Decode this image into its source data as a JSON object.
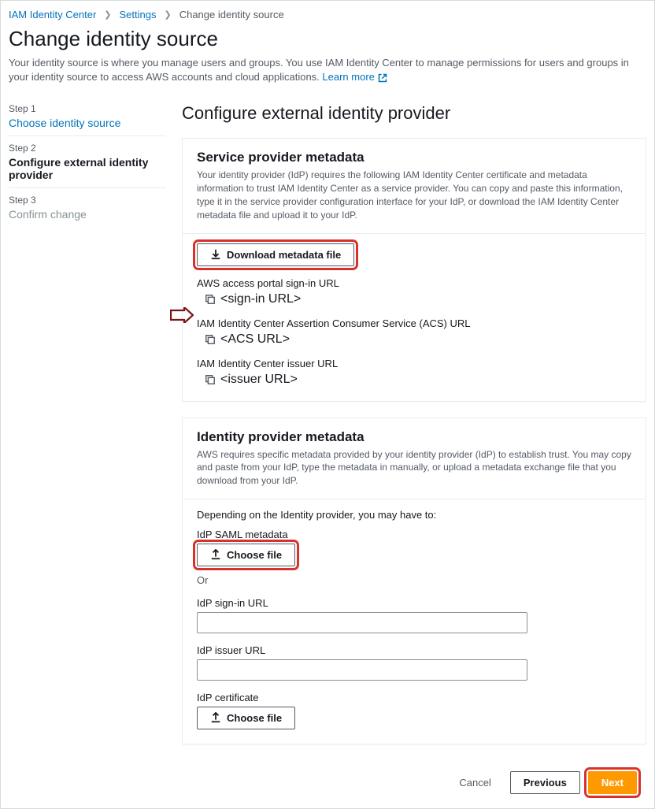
{
  "breadcrumb": {
    "item1": "IAM Identity Center",
    "item2": "Settings",
    "current": "Change identity source"
  },
  "header": {
    "title": "Change identity source",
    "subtitle_a": "Your identity source is where you manage users and groups. You use IAM Identity Center to manage permissions for users and groups in your identity source to access AWS accounts and cloud applications. ",
    "learn_more": "Learn more"
  },
  "steps": {
    "s1_label": "Step 1",
    "s1_title": "Choose identity source",
    "s2_label": "Step 2",
    "s2_title": "Configure external identity provider",
    "s3_label": "Step 3",
    "s3_title": "Confirm change"
  },
  "main": {
    "title": "Configure external identity provider"
  },
  "sp_panel": {
    "title": "Service provider metadata",
    "description": "Your identity provider (IdP) requires the following IAM Identity Center certificate and metadata information to trust IAM Identity Center as a service provider. You can copy and paste this information, type it in the service provider configuration interface for your IdP, or download the IAM Identity Center metadata file and upload it to your IdP.",
    "download_button": "Download metadata file",
    "signin_label": "AWS access portal sign-in URL",
    "signin_value": "<sign-in URL>",
    "acs_label": "IAM Identity Center Assertion Consumer Service (ACS) URL",
    "acs_value": "<ACS URL>",
    "issuer_label": "IAM Identity Center issuer URL",
    "issuer_value": "<issuer URL>"
  },
  "idp_panel": {
    "title": "Identity provider metadata",
    "description": "AWS requires specific metadata provided by your identity provider (IdP) to establish trust. You may copy and paste from your IdP, type the metadata in manually, or upload a metadata exchange file that you download from your IdP.",
    "note": "Depending on the Identity provider, you may have to:",
    "saml_label": "IdP SAML metadata",
    "choose_file": "Choose file",
    "or": "Or",
    "signin_label": "IdP sign-in URL",
    "issuer_label": "IdP issuer URL",
    "cert_label": "IdP certificate",
    "cert_choose": "Choose file"
  },
  "footer": {
    "cancel": "Cancel",
    "previous": "Previous",
    "next": "Next"
  }
}
